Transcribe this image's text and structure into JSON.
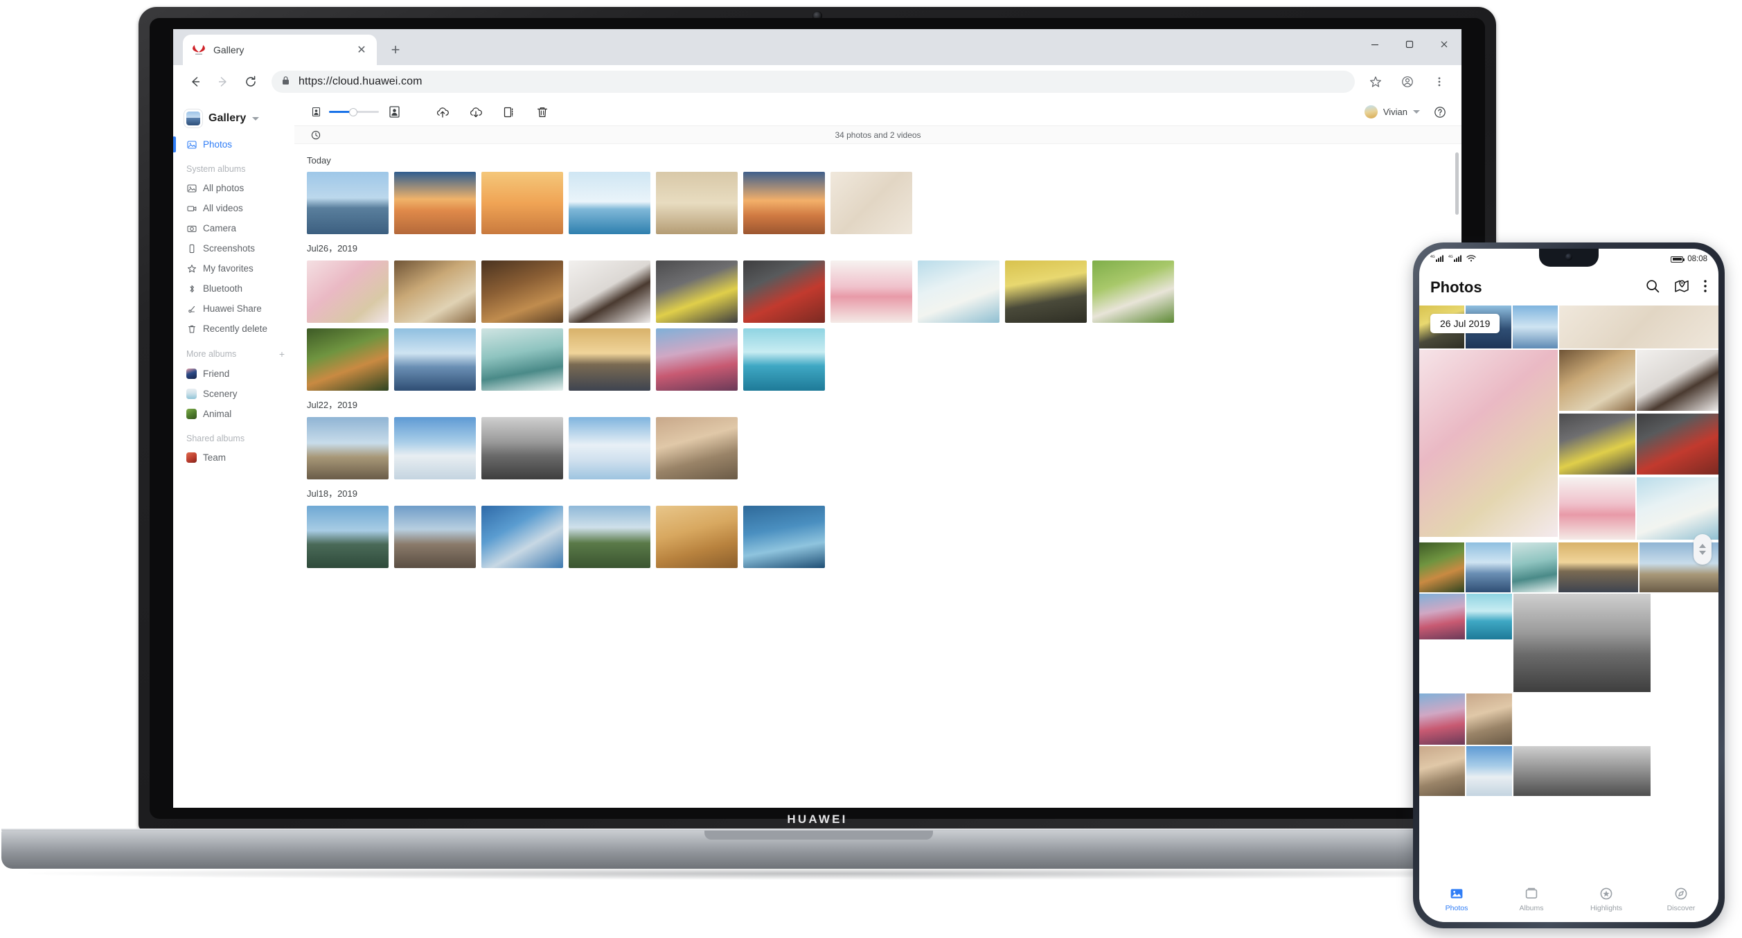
{
  "browser": {
    "tab": {
      "title": "Gallery",
      "favicon": "huawei-logo-icon",
      "close": "✕"
    },
    "new_tab": "+",
    "window_controls": {
      "minimize": "─",
      "maximize": "❐",
      "close": "✕"
    },
    "nav": {
      "back": "back-icon",
      "forward": "forward-icon",
      "reload": "reload-icon"
    },
    "url": "https://cloud.huawei.com",
    "lock": "lock-icon",
    "star": "bookmark-star-icon",
    "profile": "profile-icon",
    "menu": "kebab-menu-icon"
  },
  "laptop": {
    "brand": "HUAWEI"
  },
  "sidebar": {
    "brand_label": "Gallery",
    "primary": {
      "label": "Photos",
      "icon": "photo-icon"
    },
    "system_albums_header": "System albums",
    "system_albums": [
      {
        "label": "All photos",
        "icon": "photo-icon"
      },
      {
        "label": "All videos",
        "icon": "video-icon"
      },
      {
        "label": "Camera",
        "icon": "camera-icon"
      },
      {
        "label": "Screenshots",
        "icon": "phone-icon"
      },
      {
        "label": "My favorites",
        "icon": "star-icon"
      },
      {
        "label": "Bluetooth",
        "icon": "bluetooth-icon"
      },
      {
        "label": "Huawei Share",
        "icon": "share-icon"
      },
      {
        "label": "Recently delete",
        "icon": "trash-icon"
      }
    ],
    "more_albums_header": "More albums",
    "more_albums_add": "+",
    "more_albums": [
      {
        "label": "Friend",
        "color": "#2b4a86"
      },
      {
        "label": "Scenery",
        "color": "#bcd9e4"
      },
      {
        "label": "Animal",
        "color": "#5f8b3a"
      }
    ],
    "shared_albums_header": "Shared albums",
    "shared_albums": [
      {
        "label": "Team",
        "color": "#c94f3d"
      }
    ]
  },
  "toolbar": {
    "size_small_icon": "small-thumbnail-icon",
    "size_large_icon": "large-thumbnail-icon",
    "zoom_percent": 48,
    "actions": [
      {
        "name": "upload-icon",
        "label": "Upload"
      },
      {
        "name": "download-icon",
        "label": "Download"
      },
      {
        "name": "copy-icon",
        "label": "Copy"
      },
      {
        "name": "delete-icon",
        "label": "Delete"
      }
    ],
    "user_name": "Vivian",
    "help_icon": "help-icon",
    "history_icon": "clock-icon"
  },
  "status": {
    "count_text": "34 photos and 2 videos"
  },
  "gallery": {
    "groups": [
      {
        "date": "Today",
        "rows": [
          [
            "mountain-lake",
            "sunset-field",
            "sunrise-silhouette",
            "iceberg-sea",
            "palace-facade",
            "sunset-dunes",
            "beige-waves"
          ]
        ]
      },
      {
        "date": "Jul26，2019",
        "rows": [
          [
            "macarons-pink",
            "brunch-table",
            "steak-board",
            "cake-slice-white",
            "lemons-dark",
            "apples-red",
            "strawberry-cake",
            "lily-of-valley",
            "yellow-blossom-cafe",
            "rabbit-grass"
          ],
          [
            "corgi-grass",
            "tall-ship",
            "surfer-wave",
            "lake-sunset",
            "holi-festival",
            "tropical-pier"
          ]
        ]
      },
      {
        "date": "Jul22，2019",
        "rows": [
          [
            "istanbul-mosque",
            "snowboarder",
            "volcano-mist",
            "cloudscape",
            "hillside-town"
          ]
        ]
      },
      {
        "date": "Jul18，2019",
        "rows": [
          [
            "bali-temple",
            "amsterdam-canal",
            "highway-interchange",
            "green-mountain",
            "sand-dunes",
            "blue-ice"
          ]
        ]
      }
    ]
  },
  "phone": {
    "status": {
      "network_1": "4G",
      "network_2": "4G",
      "wifi": "wifi-icon",
      "battery": "battery-icon",
      "time": "08:08"
    },
    "header": {
      "title": "Photos",
      "search_icon": "search-icon",
      "map_icon": "map-pin-icon",
      "more_icon": "kebab-menu-icon"
    },
    "date_chip": "26 Jul 2019",
    "scroll_up": "chevron-up-icon",
    "scroll_down": "chevron-down-icon",
    "tabs": [
      {
        "label": "Photos",
        "icon": "photos-tab-icon",
        "active": true
      },
      {
        "label": "Albums",
        "icon": "albums-tab-icon",
        "active": false
      },
      {
        "label": "Highlights",
        "icon": "highlights-tab-icon",
        "active": false
      },
      {
        "label": "Discover",
        "icon": "discover-tab-icon",
        "active": false
      }
    ]
  },
  "colors": {
    "accent": "#2f7df6",
    "chrome_bg": "#dee1e6",
    "text": "#3c4043",
    "muted": "#9aa0a6"
  }
}
